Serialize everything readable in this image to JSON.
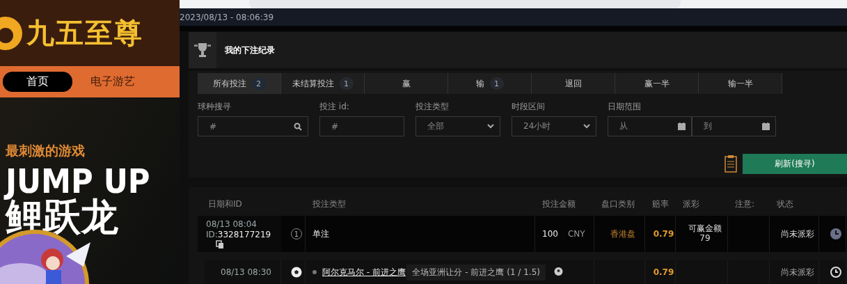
{
  "site": {
    "logo": "九五至尊",
    "nav": [
      {
        "label": "首页",
        "selected": true
      },
      {
        "label": "电子游艺",
        "selected": false
      }
    ],
    "banner": {
      "tagline": "最刺激的游戏",
      "title": "JUMP UP",
      "subtitle": "鲤跃龙"
    }
  },
  "timestamp": "2023/08/13 - 08:06:39",
  "panel": {
    "title": "我的下注纪录",
    "tabs": [
      {
        "label": "所有投注",
        "count": "2",
        "selected": true
      },
      {
        "label": "未结算投注",
        "count": "1",
        "selected": false
      },
      {
        "label": "赢",
        "selected": false
      },
      {
        "label": "输",
        "count": "1",
        "selected": false
      },
      {
        "label": "退回",
        "selected": false
      },
      {
        "label": "赢一半",
        "selected": false
      },
      {
        "label": "输一半",
        "selected": false
      }
    ],
    "filters": [
      {
        "kind": "search",
        "label": "球种搜寻",
        "placeholder": "#"
      },
      {
        "kind": "text",
        "label": "投注 id:",
        "placeholder": "#"
      },
      {
        "kind": "select",
        "label": "投注类型",
        "value": "全部"
      },
      {
        "kind": "select",
        "label": "时段区间",
        "value": "24小时"
      },
      {
        "kind": "daterange",
        "label": "日期范围",
        "from_placeholder": "从",
        "to_placeholder": "到"
      }
    ],
    "refresh_button": "刷新(搜寻)",
    "columns": [
      "日期和ID",
      "投注类型",
      "投注金额",
      "盘口类别",
      "赔率",
      "派彩",
      "注意:",
      "状态"
    ],
    "bets": [
      {
        "date": "08/13 08:04",
        "id_label": "ID:",
        "id": "3328177219",
        "legs_count": "1",
        "type": "单注",
        "amount": "100",
        "currency": "CNY",
        "market": "香港盘",
        "odds": "0.79",
        "payout_label": "可赢金额",
        "payout": "79",
        "status": "尚未派彩",
        "legs": [
          {
            "date": "08/13 08:30",
            "event": "阿尔克马尔 - 前进之鹰",
            "selection": "全场亚洲让分 - 前进之鹰 (1 / 1.5)",
            "odds": "0.79",
            "status": "尚未派彩"
          }
        ]
      }
    ]
  }
}
